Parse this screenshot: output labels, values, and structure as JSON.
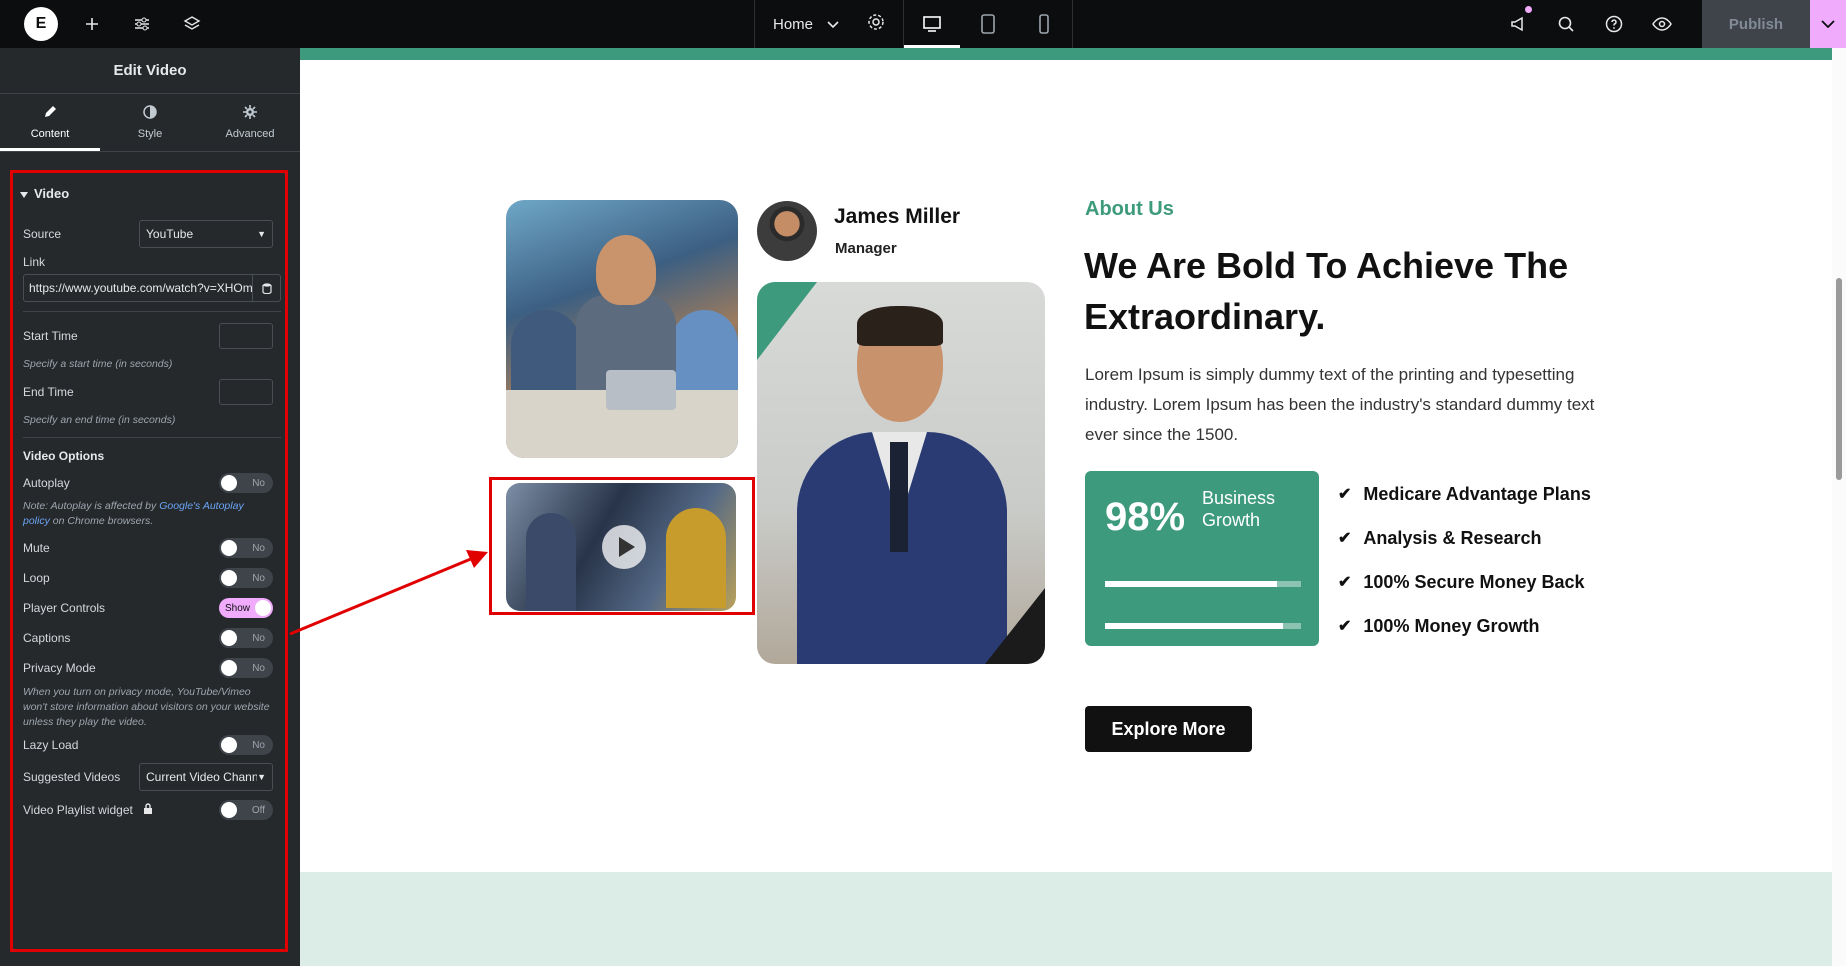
{
  "topbar": {
    "logo_letter": "E",
    "page_name": "Home",
    "publish_label": "Publish",
    "icons": [
      "plus-icon",
      "sliders-icon",
      "layers-icon",
      "settings-icon",
      "desktop-icon",
      "tablet-icon",
      "mobile-icon",
      "announcement-icon",
      "search-icon",
      "help-icon",
      "eye-icon",
      "chevron-down-icon"
    ]
  },
  "panel": {
    "title": "Edit Video",
    "tabs": [
      {
        "label": "Content",
        "icon": "pencil-icon"
      },
      {
        "label": "Style",
        "icon": "contrast-icon"
      },
      {
        "label": "Advanced",
        "icon": "gear-icon"
      }
    ],
    "section_title": "Video",
    "source": {
      "label": "Source",
      "value": "YouTube"
    },
    "link": {
      "label": "Link",
      "value": "https://www.youtube.com/watch?v=XHOm"
    },
    "start_time": {
      "label": "Start Time",
      "hint": "Specify a start time (in seconds)"
    },
    "end_time": {
      "label": "End Time",
      "hint": "Specify an end time (in seconds)"
    },
    "video_options_title": "Video Options",
    "autoplay": {
      "label": "Autoplay",
      "state": "No"
    },
    "autoplay_note_prefix": "Note: Autoplay is affected by ",
    "autoplay_note_link": "Google's Autoplay policy",
    "autoplay_note_suffix": " on Chrome browsers.",
    "mute": {
      "label": "Mute",
      "state": "No"
    },
    "loop": {
      "label": "Loop",
      "state": "No"
    },
    "player_controls": {
      "label": "Player Controls",
      "state": "Show"
    },
    "captions": {
      "label": "Captions",
      "state": "No"
    },
    "privacy_mode": {
      "label": "Privacy Mode",
      "state": "No"
    },
    "privacy_note": "When you turn on privacy mode, YouTube/Vimeo won't store information about visitors on your website unless they play the video.",
    "lazy_load": {
      "label": "Lazy Load",
      "state": "No"
    },
    "suggested_videos": {
      "label": "Suggested Videos",
      "value": "Current Video Chann"
    },
    "playlist_widget": {
      "label": "Video Playlist widget",
      "state": "Off"
    }
  },
  "canvas": {
    "person_name": "James Miller",
    "person_role": "Manager",
    "about_label": "About Us",
    "headline": "We Are Bold To Achieve The Extraordinary.",
    "paragraph": "Lorem Ipsum is simply dummy text of the printing and typesetting industry. Lorem Ipsum has been the industry's standard dummy text ever since the 1500.",
    "stat_value": "98%",
    "stat_label": "Business Growth",
    "progress": [
      0.88,
      0.91
    ],
    "checklist": [
      "Medicare Advantage Plans",
      "Analysis & Research",
      "100% Secure Money Back",
      "100% Money Growth"
    ],
    "explore_label": "Explore More"
  },
  "colors": {
    "accent_green": "#3e9a7c",
    "highlight_red": "#e00000",
    "toggle_on": "#f0abfc"
  }
}
